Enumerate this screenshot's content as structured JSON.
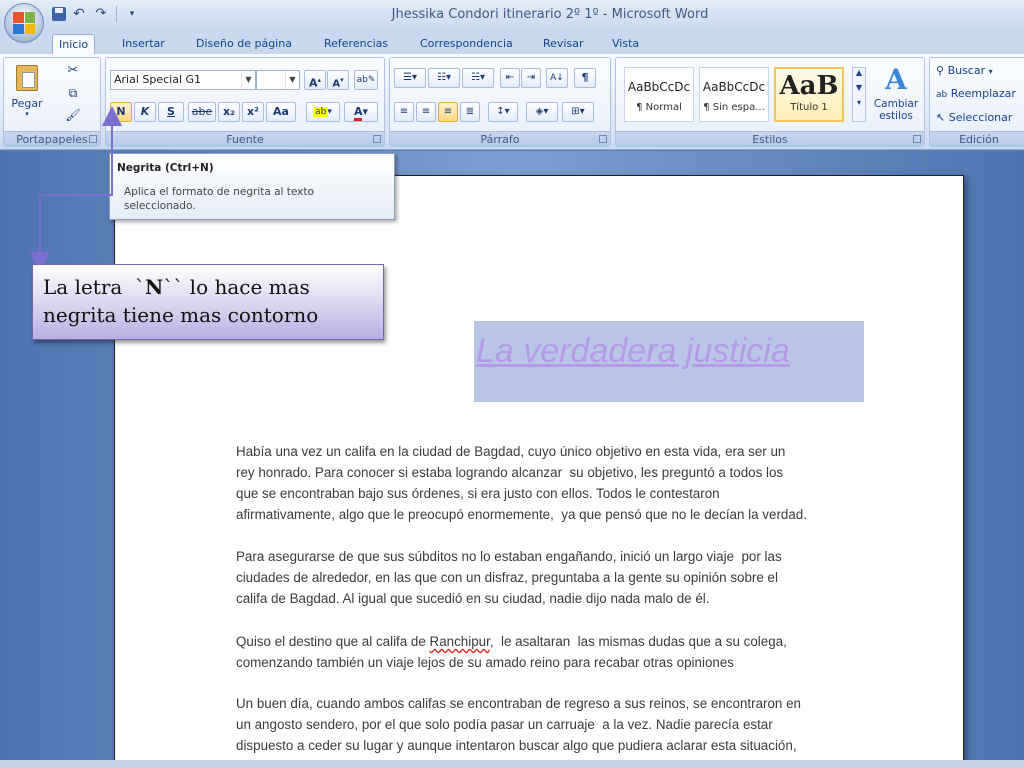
{
  "window": {
    "title": "Jhessika Condori itinerario 2º 1º - Microsoft Word"
  },
  "tabs": [
    "Inicio",
    "Insertar",
    "Diseño de página",
    "Referencias",
    "Correspondencia",
    "Revisar",
    "Vista"
  ],
  "ribbon": {
    "clipboard": {
      "paste_label": "Pegar",
      "group_label": "Portapapeles"
    },
    "font": {
      "font_name": "Arial Special G1",
      "font_size": "",
      "bold": "N",
      "italic": "K",
      "underline": "S",
      "strike": "abe",
      "subscript": "x₂",
      "superscript": "x²",
      "change_case": "Aa",
      "group_label": "Fuente"
    },
    "paragraph": {
      "group_label": "Párrafo"
    },
    "styles": {
      "items": [
        {
          "sample": "AaBbCcDc",
          "name": "¶ Normal"
        },
        {
          "sample": "AaBbCcDc",
          "name": "¶ Sin espa..."
        },
        {
          "sample": "AaB",
          "name": "Título 1"
        }
      ],
      "change_label": "Cambiar estilos",
      "group_label": "Estilos"
    },
    "editing": {
      "find": "Buscar",
      "replace": "Reemplazar",
      "select": "Seleccionar",
      "group_label": "Edición"
    }
  },
  "tooltip": {
    "title": "Negrita (Ctrl+N)",
    "body": "Aplica el formato de negrita al texto seleccionado."
  },
  "callout": {
    "line1_pre": "La letra  `",
    "line1_bold": "N",
    "line1_post": "`` lo hace mas",
    "line2": "negrita tiene mas contorno"
  },
  "document": {
    "title": "La verdadera justicia",
    "paragraphs": [
      [
        "Había una vez un califa en la ciudad de Bagdad, cuyo único objetivo en esta vida, era ser un",
        "rey honrado. Para conocer si estaba logrando alcanzar  su objetivo, les preguntó a todos los",
        "que se encontraban bajo sus órdenes, si era justo con ellos. Todos le contestaron",
        "afirmativamente, algo que le preocupó enormemente,  ya que pensó que no le decían la verdad."
      ],
      [
        "Para asegurarse de que sus súbditos no lo estaban engañando, inició un largo viaje  por las",
        "ciudades de alrededor, en las que con un disfraz, preguntaba a la gente su opinión sobre el",
        "califa de Bagdad. Al igual que sucedió en su ciudad, nadie dijo nada malo de él."
      ],
      [
        "Quiso el destino que al califa de Ranchipur,  le asaltaran  las mismas dudas que a su colega,",
        "comenzando también un viaje lejos de su amado reino para recabar otras opiniones"
      ],
      [
        "Un buen día, cuando ambos califas se encontraban de regreso a sus reinos, se encontraron en",
        "un angosto sendero, por el que solo podía pasar un carruaje  a la vez. Nadie parecía estar",
        "dispuesto a ceder su lugar y aunque intentaron buscar algo que pudiera aclarar esta situación,"
      ]
    ]
  }
}
